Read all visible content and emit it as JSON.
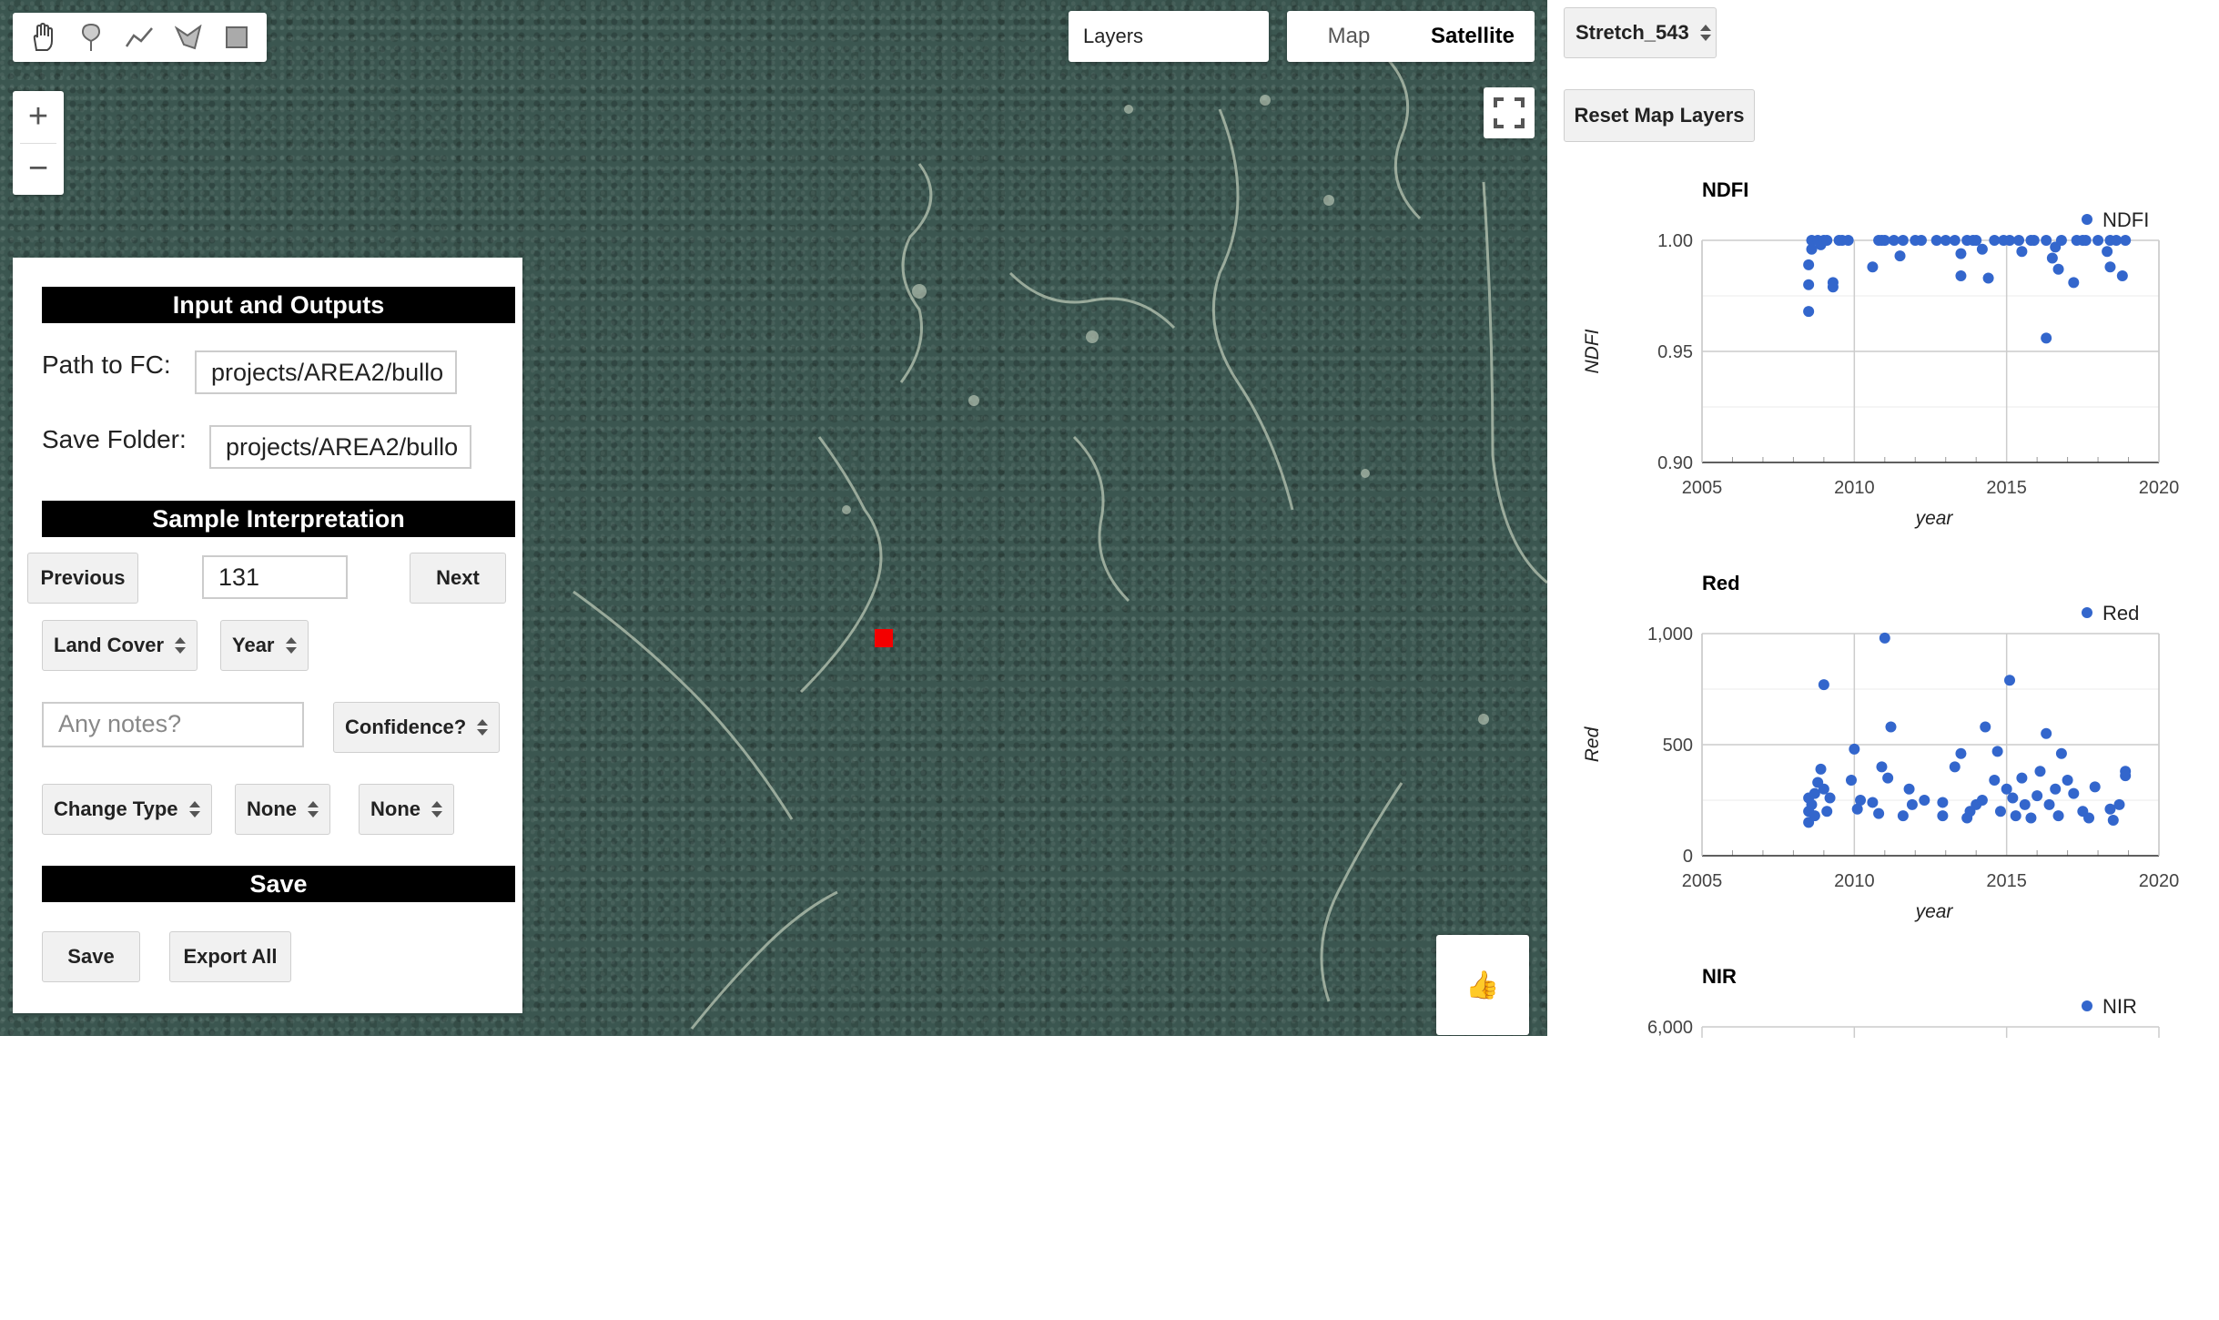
{
  "map": {
    "toolbar": {
      "tools": [
        {
          "icon": "hand-icon"
        },
        {
          "icon": "marker-icon"
        },
        {
          "icon": "polyline-icon"
        },
        {
          "icon": "polygon-icon"
        },
        {
          "icon": "rectangle-icon"
        }
      ]
    },
    "zoom": {
      "in": "+",
      "out": "−"
    },
    "layers_label": "Layers",
    "map_type": {
      "map": "Map",
      "satellite": "Satellite"
    },
    "thumb": "👍"
  },
  "panel": {
    "io_header": "Input and Outputs",
    "path_label": "Path to FC:",
    "path_value": "projects/AREA2/bullo",
    "save_folder_label": "Save Folder:",
    "save_folder_value": "projects/AREA2/bullo",
    "sample_header": "Sample Interpretation",
    "previous_label": "Previous",
    "sample_index": "131",
    "next_label": "Next",
    "land_cover_label": "Land Cover",
    "year_label": "Year",
    "notes_placeholder": "Any notes?",
    "confidence_label": "Confidence?",
    "change_type_label": "Change Type",
    "none_1": "None",
    "none_2": "None",
    "save_header": "Save",
    "save_label": "Save",
    "export_label": "Export All"
  },
  "right": {
    "stretch_value": "Stretch_543",
    "reset_label": "Reset Map Layers"
  },
  "chart_data": [
    {
      "type": "scatter",
      "title": "NDFI",
      "xlabel": "year",
      "ylabel": "NDFI",
      "series_name": "NDFI",
      "xlim": [
        2005,
        2020
      ],
      "ylim": [
        0.9,
        1.0
      ],
      "yticks": [
        0.9,
        0.95,
        1.0
      ],
      "ytick_labels": [
        "0.90",
        "0.95",
        "1.00"
      ],
      "xticks": [
        2005,
        2010,
        2015,
        2020
      ],
      "color": "#3366cc",
      "legend": "top-right",
      "points": [
        [
          2008.5,
          0.968
        ],
        [
          2008.5,
          0.98
        ],
        [
          2008.5,
          0.989
        ],
        [
          2008.6,
          0.996
        ],
        [
          2008.6,
          1.0
        ],
        [
          2008.8,
          1.0
        ],
        [
          2008.9,
          0.998
        ],
        [
          2009.0,
          1.0
        ],
        [
          2009.1,
          1.0
        ],
        [
          2009.3,
          0.981
        ],
        [
          2009.3,
          0.979
        ],
        [
          2009.5,
          1.0
        ],
        [
          2009.6,
          1.0
        ],
        [
          2009.8,
          1.0
        ],
        [
          2010.6,
          0.988
        ],
        [
          2010.8,
          1.0
        ],
        [
          2010.9,
          1.0
        ],
        [
          2011.0,
          1.0
        ],
        [
          2011.3,
          1.0
        ],
        [
          2011.5,
          0.993
        ],
        [
          2011.6,
          1.0
        ],
        [
          2012.0,
          1.0
        ],
        [
          2012.2,
          1.0
        ],
        [
          2012.7,
          1.0
        ],
        [
          2013.0,
          1.0
        ],
        [
          2013.3,
          1.0
        ],
        [
          2013.5,
          0.984
        ],
        [
          2013.5,
          0.994
        ],
        [
          2013.7,
          1.0
        ],
        [
          2013.9,
          1.0
        ],
        [
          2014.0,
          1.0
        ],
        [
          2014.2,
          0.996
        ],
        [
          2014.4,
          0.983
        ],
        [
          2014.6,
          1.0
        ],
        [
          2014.9,
          1.0
        ],
        [
          2015.1,
          1.0
        ],
        [
          2015.4,
          1.0
        ],
        [
          2015.5,
          0.995
        ],
        [
          2015.8,
          1.0
        ],
        [
          2015.9,
          1.0
        ],
        [
          2016.3,
          0.956
        ],
        [
          2016.3,
          1.0
        ],
        [
          2016.5,
          0.992
        ],
        [
          2016.6,
          0.997
        ],
        [
          2016.7,
          0.987
        ],
        [
          2016.8,
          1.0
        ],
        [
          2017.2,
          0.981
        ],
        [
          2017.3,
          1.0
        ],
        [
          2017.5,
          1.0
        ],
        [
          2017.6,
          1.0
        ],
        [
          2018.0,
          1.0
        ],
        [
          2018.3,
          0.995
        ],
        [
          2018.4,
          0.988
        ],
        [
          2018.4,
          1.0
        ],
        [
          2018.6,
          1.0
        ],
        [
          2018.8,
          0.984
        ],
        [
          2018.9,
          1.0
        ]
      ]
    },
    {
      "type": "scatter",
      "title": "Red",
      "xlabel": "year",
      "ylabel": "Red",
      "series_name": "Red",
      "xlim": [
        2005,
        2020
      ],
      "ylim": [
        0,
        1000
      ],
      "yticks": [
        0,
        500,
        1000
      ],
      "ytick_labels": [
        "0",
        "500",
        "1,000"
      ],
      "xticks": [
        2005,
        2010,
        2015,
        2020
      ],
      "color": "#3366cc",
      "legend": "top-right",
      "points": [
        [
          2008.5,
          150
        ],
        [
          2008.5,
          200
        ],
        [
          2008.5,
          260
        ],
        [
          2008.6,
          230
        ],
        [
          2008.7,
          180
        ],
        [
          2008.7,
          280
        ],
        [
          2008.8,
          330
        ],
        [
          2008.9,
          390
        ],
        [
          2009.0,
          300
        ],
        [
          2009.0,
          770
        ],
        [
          2009.1,
          200
        ],
        [
          2009.2,
          260
        ],
        [
          2009.9,
          340
        ],
        [
          2010.1,
          210
        ],
        [
          2010.2,
          250
        ],
        [
          2010.0,
          480
        ],
        [
          2010.6,
          240
        ],
        [
          2010.8,
          190
        ],
        [
          2010.9,
          400
        ],
        [
          2011.0,
          980
        ],
        [
          2011.1,
          350
        ],
        [
          2011.2,
          580
        ],
        [
          2011.6,
          180
        ],
        [
          2011.8,
          300
        ],
        [
          2011.9,
          230
        ],
        [
          2012.3,
          250
        ],
        [
          2012.9,
          180
        ],
        [
          2012.9,
          240
        ],
        [
          2013.3,
          400
        ],
        [
          2013.5,
          460
        ],
        [
          2013.7,
          170
        ],
        [
          2013.8,
          200
        ],
        [
          2014.0,
          230
        ],
        [
          2014.2,
          250
        ],
        [
          2014.3,
          580
        ],
        [
          2014.6,
          340
        ],
        [
          2014.7,
          470
        ],
        [
          2014.8,
          200
        ],
        [
          2015.0,
          300
        ],
        [
          2015.1,
          790
        ],
        [
          2015.2,
          260
        ],
        [
          2015.3,
          180
        ],
        [
          2015.5,
          350
        ],
        [
          2015.6,
          230
        ],
        [
          2015.8,
          170
        ],
        [
          2016.0,
          270
        ],
        [
          2016.1,
          380
        ],
        [
          2016.3,
          550
        ],
        [
          2016.4,
          230
        ],
        [
          2016.6,
          300
        ],
        [
          2016.7,
          180
        ],
        [
          2016.8,
          460
        ],
        [
          2017.0,
          340
        ],
        [
          2017.2,
          280
        ],
        [
          2017.5,
          200
        ],
        [
          2017.7,
          170
        ],
        [
          2017.9,
          310
        ],
        [
          2018.4,
          210
        ],
        [
          2018.5,
          160
        ],
        [
          2018.7,
          230
        ],
        [
          2018.9,
          380
        ],
        [
          2018.9,
          360
        ]
      ]
    },
    {
      "type": "scatter",
      "title": "NIR",
      "xlabel": "",
      "ylabel": "",
      "series_name": "NIR",
      "xlim": [
        2005,
        2020
      ],
      "ylim": [
        0,
        6000
      ],
      "yticks": [
        6000
      ],
      "ytick_labels": [
        "6,000"
      ],
      "xticks": [],
      "color": "#3366cc",
      "legend": "top-right",
      "points": []
    }
  ]
}
